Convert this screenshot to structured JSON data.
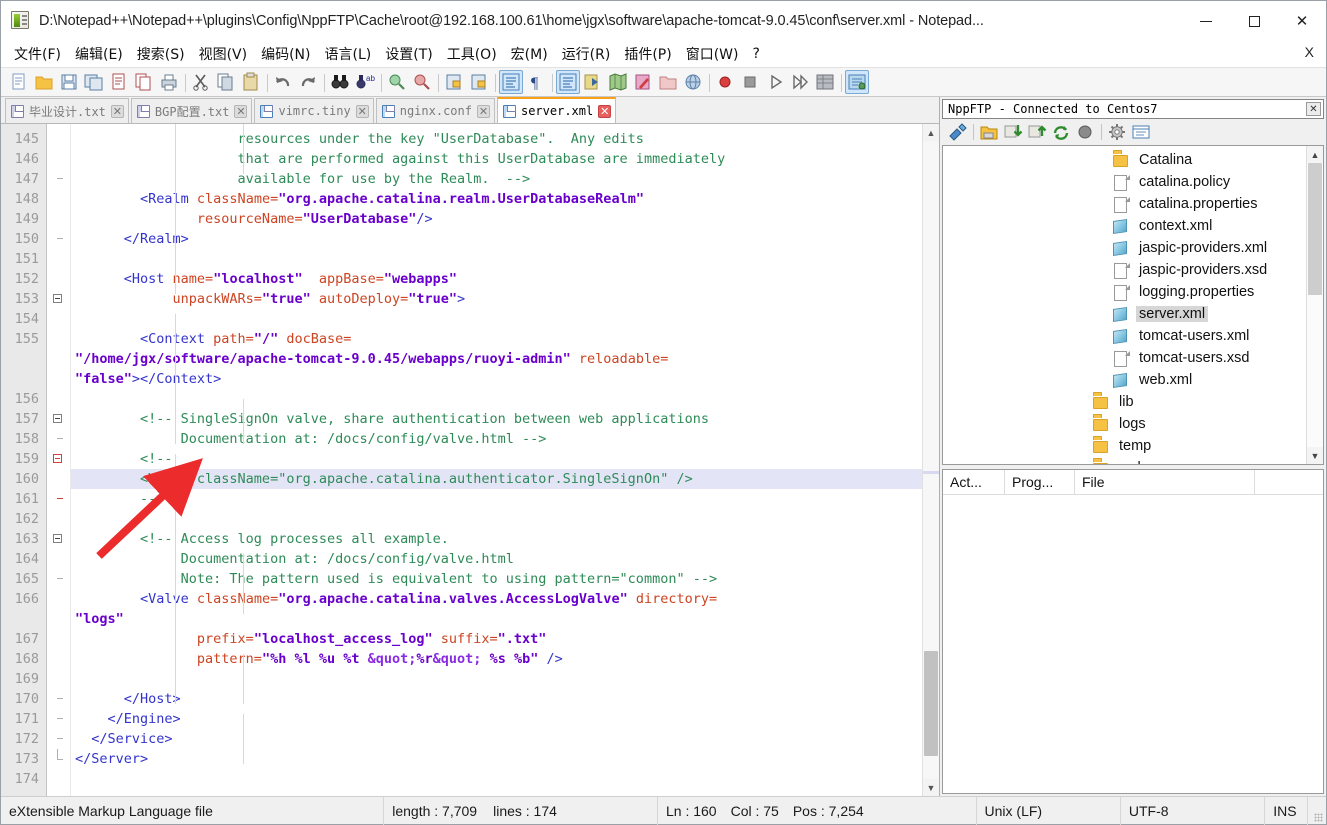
{
  "window": {
    "title": "D:\\Notepad++\\Notepad++\\plugins\\Config\\NppFTP\\Cache\\root@192.168.100.61\\home\\jgx\\software\\apache-tomcat-9.0.45\\conf\\server.xml - Notepad...",
    "app_icon": "notepad-plus-plus-icon",
    "minimize_label": "",
    "maximize_label": "",
    "close_label": "✕"
  },
  "menubar": {
    "items": [
      {
        "label": "文件(F)",
        "name": "menu-file"
      },
      {
        "label": "编辑(E)",
        "name": "menu-edit"
      },
      {
        "label": "搜索(S)",
        "name": "menu-search"
      },
      {
        "label": "视图(V)",
        "name": "menu-view"
      },
      {
        "label": "编码(N)",
        "name": "menu-encoding"
      },
      {
        "label": "语言(L)",
        "name": "menu-language"
      },
      {
        "label": "设置(T)",
        "name": "menu-settings"
      },
      {
        "label": "工具(O)",
        "name": "menu-tools"
      },
      {
        "label": "宏(M)",
        "name": "menu-macro"
      },
      {
        "label": "运行(R)",
        "name": "menu-run"
      },
      {
        "label": "插件(P)",
        "name": "menu-plugins"
      },
      {
        "label": "窗口(W)",
        "name": "menu-window"
      },
      {
        "label": "?",
        "name": "menu-help"
      }
    ],
    "close_document": "X"
  },
  "toolbar": {
    "buttons": [
      "new-file-icon",
      "open-file-icon",
      "save-icon",
      "save-all-icon",
      "close-file-icon",
      "close-all-icon",
      "print-icon",
      "sep",
      "cut-icon",
      "copy-icon",
      "paste-icon",
      "sep",
      "undo-icon",
      "redo-icon",
      "sep",
      "find-icon",
      "replace-icon",
      "sep",
      "zoom-in-icon",
      "zoom-out-icon",
      "sep",
      "sync-vertical-scroll-icon",
      "sync-horizontal-scroll-icon",
      "sep",
      "word-wrap-icon",
      "show-all-chars-icon",
      "sep",
      "indent-guide-icon",
      "ui-mode-icon",
      "show-symbol-icon",
      "user-defined-dialog-icon",
      "document-map-icon",
      "document-list-icon",
      "sep",
      "macro-record-icon",
      "macro-stop-icon",
      "macro-play-icon",
      "macro-run-multiple-icon",
      "run-macro-dialog-icon",
      "sep",
      "ftp-icon"
    ]
  },
  "tabs": [
    {
      "label": "毕业设计.txt",
      "name": "tab-biyesheji-txt",
      "active": false,
      "saved": false
    },
    {
      "label": "BGP配置.txt",
      "name": "tab-bgp-peizhi-txt",
      "active": false,
      "saved": false
    },
    {
      "label": "vimrc.tiny",
      "name": "tab-vimrc-tiny",
      "active": false,
      "saved": true
    },
    {
      "label": "nginx.conf",
      "name": "tab-nginx-conf",
      "active": false,
      "saved": true
    },
    {
      "label": "server.xml",
      "name": "tab-server-xml",
      "active": true,
      "saved": true
    }
  ],
  "editor": {
    "first_line": 145,
    "current_line": 160,
    "lines": [
      {
        "num": 145,
        "fold": "none",
        "tokens": [
          {
            "t": "com",
            "s": "                    resources under the key \"UserDatabase\".  Any edits"
          }
        ]
      },
      {
        "num": 146,
        "fold": "none",
        "tokens": [
          {
            "t": "com",
            "s": "                    that are performed against this UserDatabase are immediately"
          }
        ]
      },
      {
        "num": 147,
        "fold": "tick",
        "tokens": [
          {
            "t": "com",
            "s": "                    available for use by the Realm.  -->"
          }
        ]
      },
      {
        "num": 148,
        "fold": "none",
        "tokens": [
          {
            "t": "tag",
            "s": "        <Realm "
          },
          {
            "t": "attr",
            "s": "className="
          },
          {
            "t": "val",
            "s": "\"org.apache.catalina.realm.UserDatabaseRealm\""
          }
        ]
      },
      {
        "num": 149,
        "fold": "none",
        "tokens": [
          {
            "t": "attr",
            "s": "               resourceName="
          },
          {
            "t": "val",
            "s": "\"UserDatabase\""
          },
          {
            "t": "tag",
            "s": "/>"
          }
        ]
      },
      {
        "num": 150,
        "fold": "tick",
        "tokens": [
          {
            "t": "tag",
            "s": "      </Realm>"
          }
        ]
      },
      {
        "num": 151,
        "fold": "none",
        "tokens": [
          {
            "t": "txt",
            "s": ""
          }
        ]
      },
      {
        "num": 152,
        "fold": "none",
        "tokens": [
          {
            "t": "tag",
            "s": "      <Host "
          },
          {
            "t": "attr",
            "s": "name="
          },
          {
            "t": "val",
            "s": "\"localhost\""
          },
          {
            "t": "attr",
            "s": "  appBase="
          },
          {
            "t": "val",
            "s": "\"webapps\""
          }
        ]
      },
      {
        "num": 153,
        "fold": "box",
        "tokens": [
          {
            "t": "attr",
            "s": "            unpackWARs="
          },
          {
            "t": "val",
            "s": "\"true\""
          },
          {
            "t": "attr",
            "s": " autoDeploy="
          },
          {
            "t": "val",
            "s": "\"true\""
          },
          {
            "t": "tag",
            "s": ">"
          }
        ]
      },
      {
        "num": 154,
        "fold": "none",
        "tokens": [
          {
            "t": "txt",
            "s": ""
          }
        ]
      },
      {
        "num": 155,
        "fold": "none",
        "tokens": [
          {
            "t": "tag",
            "s": "        <Context "
          },
          {
            "t": "attr",
            "s": "path="
          },
          {
            "t": "val",
            "s": "\"/\""
          },
          {
            "t": "attr",
            "s": " docBase="
          }
        ]
      },
      {
        "num": null,
        "fold": "none",
        "tokens": [
          {
            "t": "val",
            "s": "\"/home/jgx/software/apache-tomcat-9.0.45/webapps/ruoyi-admin\""
          },
          {
            "t": "attr",
            "s": " reloadable="
          }
        ]
      },
      {
        "num": null,
        "fold": "none",
        "tokens": [
          {
            "t": "val",
            "s": "\"false\""
          },
          {
            "t": "tag",
            "s": "></Context>"
          }
        ]
      },
      {
        "num": 156,
        "fold": "none",
        "tokens": [
          {
            "t": "txt",
            "s": ""
          }
        ]
      },
      {
        "num": 157,
        "fold": "box",
        "tokens": [
          {
            "t": "com",
            "s": "        <!-- SingleSignOn valve, share authentication between web applications"
          }
        ]
      },
      {
        "num": 158,
        "fold": "tick",
        "tokens": [
          {
            "t": "com",
            "s": "             Documentation at: /docs/config/valve.html -->"
          }
        ]
      },
      {
        "num": 159,
        "fold": "redbox",
        "tokens": [
          {
            "t": "com",
            "s": "        <!--"
          }
        ]
      },
      {
        "num": 160,
        "fold": "redline",
        "current": true,
        "tokens": [
          {
            "t": "com",
            "s": "        <Valve className=\"org.apache.catalina.authenticator.SingleSignOn\" />"
          }
        ]
      },
      {
        "num": 161,
        "fold": "redtick",
        "tokens": [
          {
            "t": "com",
            "s": "        -->"
          }
        ]
      },
      {
        "num": 162,
        "fold": "none",
        "tokens": [
          {
            "t": "txt",
            "s": ""
          }
        ]
      },
      {
        "num": 163,
        "fold": "box",
        "tokens": [
          {
            "t": "com",
            "s": "        <!-- Access log processes all example."
          }
        ]
      },
      {
        "num": 164,
        "fold": "none",
        "tokens": [
          {
            "t": "com",
            "s": "             Documentation at: /docs/config/valve.html"
          }
        ]
      },
      {
        "num": 165,
        "fold": "tick",
        "tokens": [
          {
            "t": "com",
            "s": "             Note: The pattern used is equivalent to using pattern=\"common\" -->"
          }
        ]
      },
      {
        "num": 166,
        "fold": "none",
        "tokens": [
          {
            "t": "tag",
            "s": "        <Valve "
          },
          {
            "t": "attr",
            "s": "className="
          },
          {
            "t": "val",
            "s": "\"org.apache.catalina.valves.AccessLogValve\""
          },
          {
            "t": "attr",
            "s": " directory="
          }
        ]
      },
      {
        "num": null,
        "fold": "none",
        "tokens": [
          {
            "t": "val",
            "s": "\"logs\""
          }
        ]
      },
      {
        "num": 167,
        "fold": "none",
        "tokens": [
          {
            "t": "attr",
            "s": "               prefix="
          },
          {
            "t": "val",
            "s": "\"localhost_access_log\""
          },
          {
            "t": "attr",
            "s": " suffix="
          },
          {
            "t": "val",
            "s": "\".txt\""
          }
        ]
      },
      {
        "num": 168,
        "fold": "none",
        "tokens": [
          {
            "t": "attr",
            "s": "               pattern="
          },
          {
            "t": "val",
            "s": "\"%h %l %u %t "
          },
          {
            "t": "ent",
            "s": "&quot;"
          },
          {
            "t": "val",
            "s": "%r"
          },
          {
            "t": "ent",
            "s": "&quot;"
          },
          {
            "t": "val",
            "s": " %s %b\""
          },
          {
            "t": "tag",
            "s": " />"
          }
        ]
      },
      {
        "num": 169,
        "fold": "none",
        "tokens": [
          {
            "t": "txt",
            "s": ""
          }
        ]
      },
      {
        "num": 170,
        "fold": "tick",
        "tokens": [
          {
            "t": "tag",
            "s": "      </Host>"
          }
        ]
      },
      {
        "num": 171,
        "fold": "tick",
        "tokens": [
          {
            "t": "tag",
            "s": "    </Engine>"
          }
        ]
      },
      {
        "num": 172,
        "fold": "tick",
        "tokens": [
          {
            "t": "tag",
            "s": "  </Service>"
          }
        ]
      },
      {
        "num": 173,
        "fold": "end",
        "tokens": [
          {
            "t": "tag",
            "s": "</Server>"
          }
        ]
      },
      {
        "num": 174,
        "fold": "none",
        "tokens": [
          {
            "t": "txt",
            "s": ""
          }
        ]
      }
    ]
  },
  "ftp_panel": {
    "title": "NppFTP - Connected to Centos7",
    "close_label": "✕",
    "toolbar": [
      "connect-icon",
      "sep",
      "open-directory-icon",
      "download-icon",
      "upload-icon",
      "refresh-icon",
      "abort-icon",
      "sep",
      "settings-icon",
      "messages-icon"
    ],
    "tree": [
      {
        "label": "Catalina",
        "icon": "folder-icon",
        "indent": 1,
        "selected": false
      },
      {
        "label": "catalina.policy",
        "icon": "file-icon",
        "indent": 1,
        "selected": false
      },
      {
        "label": "catalina.properties",
        "icon": "file-icon",
        "indent": 1,
        "selected": false
      },
      {
        "label": "context.xml",
        "icon": "xml-file-icon",
        "indent": 1,
        "selected": false
      },
      {
        "label": "jaspic-providers.xml",
        "icon": "xml-file-icon",
        "indent": 1,
        "selected": false
      },
      {
        "label": "jaspic-providers.xsd",
        "icon": "file-icon",
        "indent": 1,
        "selected": false
      },
      {
        "label": "logging.properties",
        "icon": "file-icon",
        "indent": 1,
        "selected": false
      },
      {
        "label": "server.xml",
        "icon": "xml-file-icon",
        "indent": 1,
        "selected": true
      },
      {
        "label": "tomcat-users.xml",
        "icon": "xml-file-icon",
        "indent": 1,
        "selected": false
      },
      {
        "label": "tomcat-users.xsd",
        "icon": "file-icon",
        "indent": 1,
        "selected": false
      },
      {
        "label": "web.xml",
        "icon": "xml-file-icon",
        "indent": 1,
        "selected": false
      },
      {
        "label": "lib",
        "icon": "folder-icon",
        "indent": 0,
        "selected": false
      },
      {
        "label": "logs",
        "icon": "folder-icon",
        "indent": 0,
        "selected": false
      },
      {
        "label": "temp",
        "icon": "folder-icon",
        "indent": 0,
        "selected": false
      },
      {
        "label": "webapps",
        "icon": "folder-icon",
        "indent": 0,
        "selected": false
      }
    ],
    "queue_columns": [
      "Act...",
      "Prog...",
      "File"
    ]
  },
  "statusbar": {
    "file_type": "eXtensible Markup Language file",
    "length": "length : 7,709",
    "lines": "lines : 174",
    "ln": "Ln : 160",
    "col": "Col : 75",
    "pos": "Pos : 7,254",
    "eol": "Unix (LF)",
    "encoding": "UTF-8",
    "insert_mode": "INS"
  },
  "colors": {
    "accent_tab": "#f7a11a",
    "comment": "#2e8b57",
    "tag": "#3333cc",
    "attribute": "#cc4422",
    "value": "#6a00cc",
    "current_line": "#e4e4f7",
    "annotation_arrow": "#ec2c2c"
  }
}
